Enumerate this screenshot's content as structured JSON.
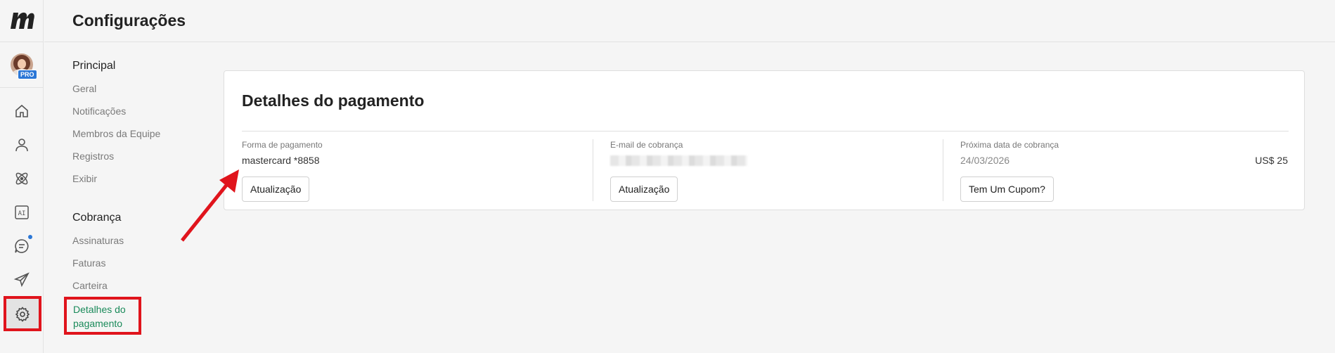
{
  "app": {
    "logo_letter": "m"
  },
  "user": {
    "badge": "PRO"
  },
  "rail": {
    "icons": [
      "home-icon",
      "user-icon",
      "atom-icon",
      "ai-icon",
      "chat-icon",
      "send-icon",
      "gear-icon"
    ]
  },
  "header": {
    "title": "Configurações"
  },
  "nav": {
    "sections": [
      {
        "heading": "Principal",
        "items": [
          "Geral",
          "Notificações",
          "Membros da Equipe",
          "Registros",
          "Exibir"
        ]
      },
      {
        "heading": "Cobrança",
        "items": [
          "Assinaturas",
          "Faturas",
          "Carteira",
          "Detalhes do pagamento"
        ]
      }
    ],
    "active_line1": "Detalhes do",
    "active_line2": "pagamento"
  },
  "payment": {
    "title": "Detalhes do pagamento",
    "method_label": "Forma de pagamento",
    "method_value": "mastercard *8858",
    "method_button": "Atualização",
    "email_label": "E-mail de cobrança",
    "email_button": "Atualização",
    "next_label": "Próxima data de cobrança",
    "next_date": "24/03/2026",
    "next_amount": "US$ 25",
    "coupon_button": "Tem Um Cupom?"
  },
  "colors": {
    "accent": "#1a8a5a",
    "highlight": "#e0141c",
    "badge": "#2b77d6"
  }
}
